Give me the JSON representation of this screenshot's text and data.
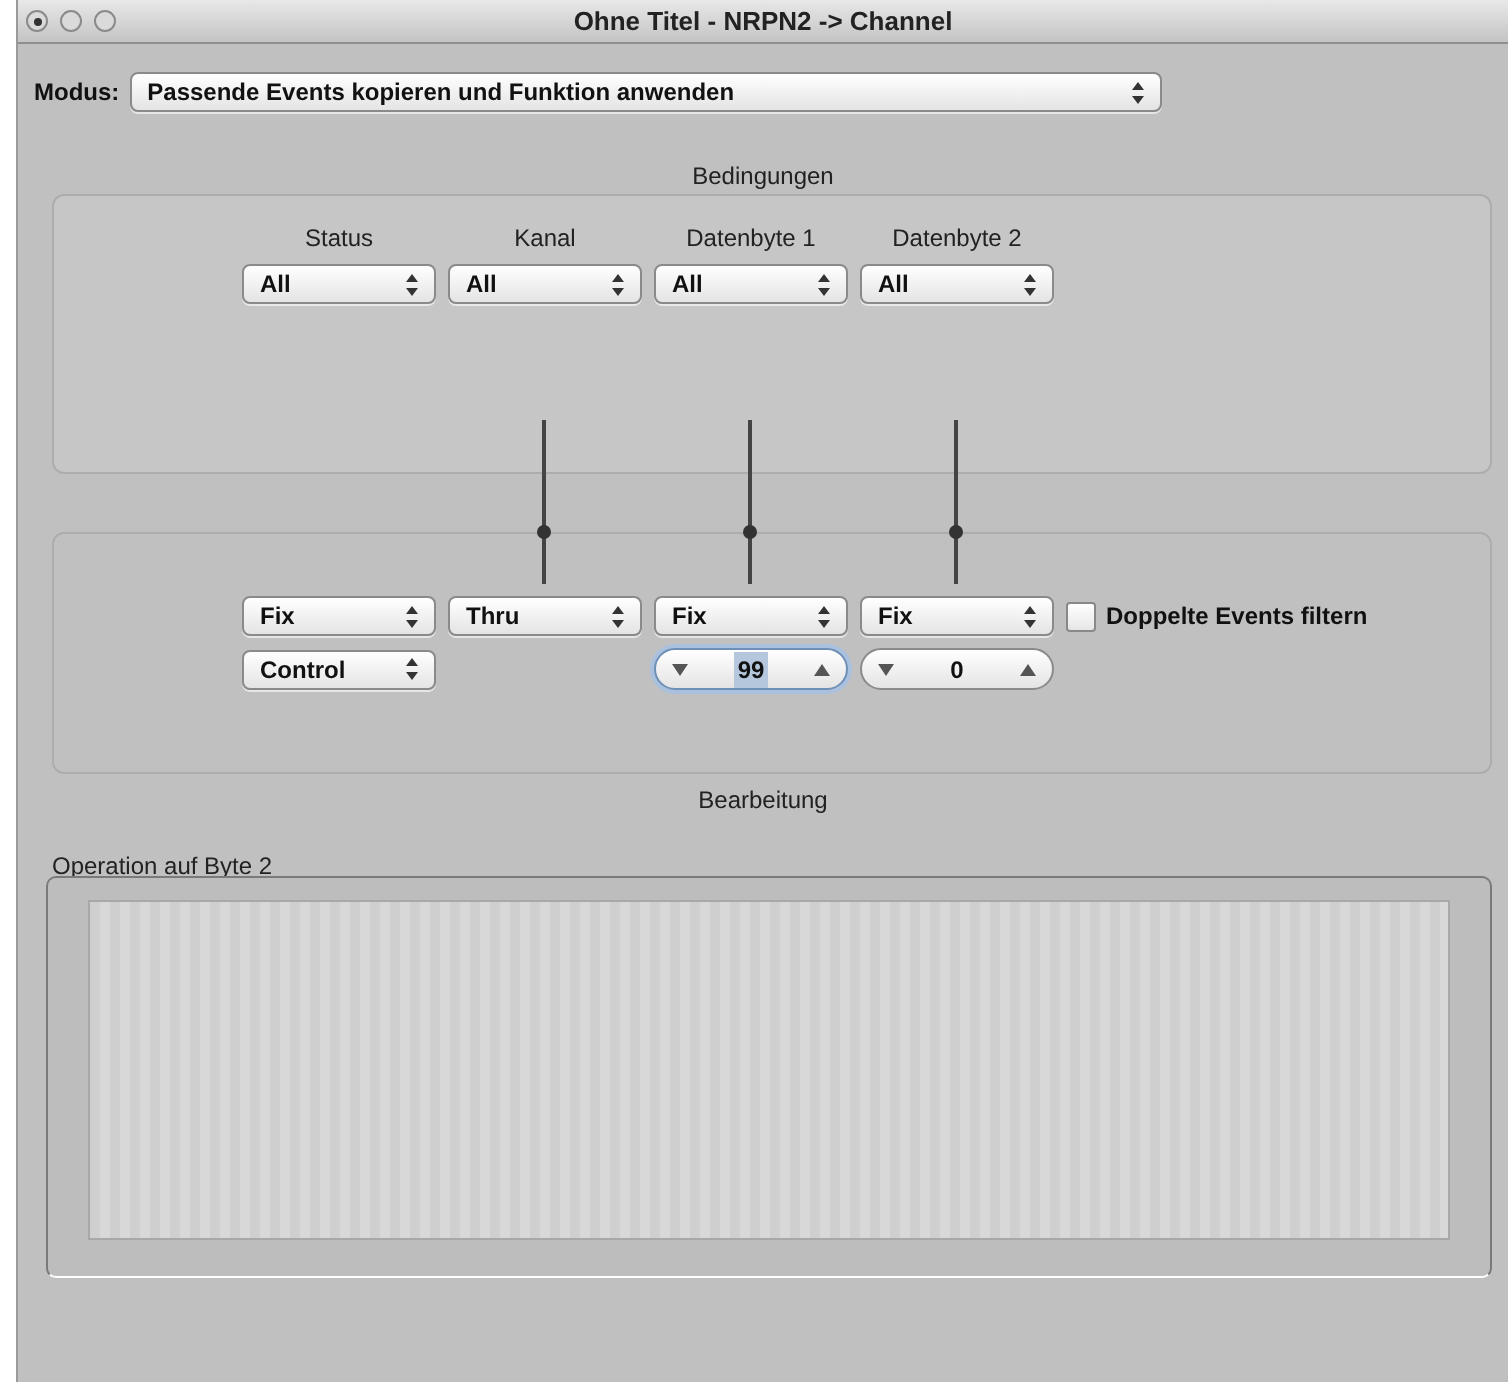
{
  "window": {
    "title": "Ohne Titel - NRPN2 -> Channel",
    "document_edited": true
  },
  "mode": {
    "label": "Modus:",
    "value": "Passende Events kopieren und Funktion anwenden"
  },
  "conditions": {
    "title": "Bedingungen",
    "columns": [
      {
        "header": "Status",
        "value": "All"
      },
      {
        "header": "Kanal",
        "value": "All"
      },
      {
        "header": "Datenbyte 1",
        "value": "All"
      },
      {
        "header": "Datenbyte 2",
        "value": "All"
      }
    ]
  },
  "processing": {
    "title": "Bearbeitung",
    "operations": [
      {
        "value": "Fix",
        "connected": false
      },
      {
        "value": "Thru",
        "connected": true
      },
      {
        "value": "Fix",
        "connected": true
      },
      {
        "value": "Fix",
        "connected": true
      }
    ],
    "filter_duplicates": {
      "label": "Doppelte Events filtern",
      "checked": false
    },
    "values": [
      {
        "kind": "select",
        "value": "Control"
      },
      {
        "kind": "none"
      },
      {
        "kind": "spinner",
        "value": "99",
        "focused": true
      },
      {
        "kind": "spinner",
        "value": "0",
        "focused": false
      }
    ]
  },
  "operation_area": {
    "title": "Operation auf Byte 2"
  }
}
